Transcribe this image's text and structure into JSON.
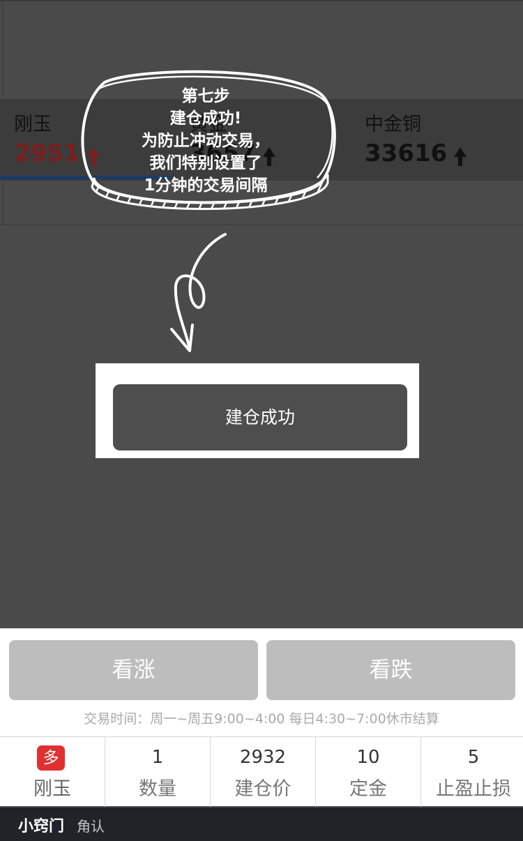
{
  "ticker": {
    "items": [
      {
        "name": "刚玉",
        "price": "2951",
        "color": "#7a1f1f"
      },
      {
        "name": "黄金",
        "price": "3657",
        "color": "#111111"
      },
      {
        "name": "中金铜",
        "price": "33616",
        "color": "#111111"
      }
    ]
  },
  "tutorial": {
    "lines": [
      "第七步",
      "建仓成功!",
      "为防止冲动交易，",
      "我们特别设置了",
      "1分钟的交易间隔"
    ]
  },
  "toast": {
    "message": "建仓成功"
  },
  "actions": {
    "buy_label": "看涨",
    "sell_label": "看跌"
  },
  "trade_hours": "交易时间：周一~周五9:00~4:00 每日4:30~7:00休市结算",
  "position": {
    "direction_badge": "多",
    "product": "刚玉",
    "quantity": "1",
    "quantity_label": "数量",
    "open_price": "2932",
    "open_price_label": "建仓价",
    "deposit": "10",
    "deposit_label": "定金",
    "stop": "5",
    "stop_label": "止盈止损"
  },
  "footer": {
    "brand": "小窍门",
    "sub": "角认"
  },
  "colors": {
    "overlay": "#4a4a4a",
    "badge": "#e03030",
    "button": "#bdbdbd"
  }
}
